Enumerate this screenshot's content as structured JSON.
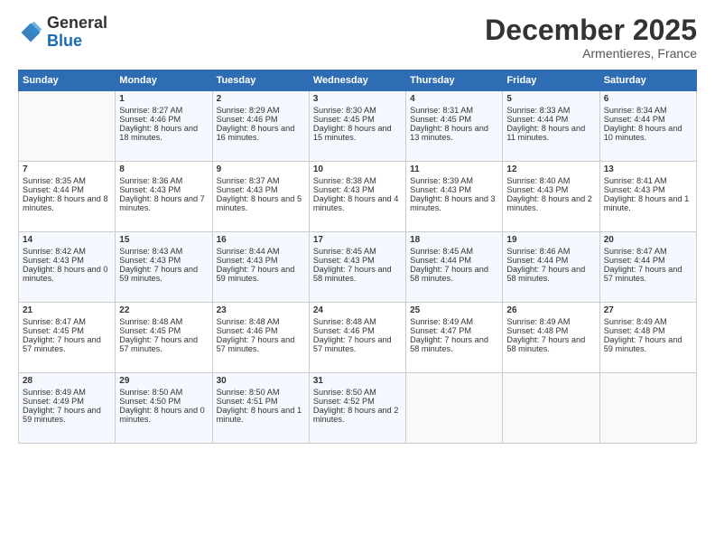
{
  "header": {
    "logo_general": "General",
    "logo_blue": "Blue",
    "month_title": "December 2025",
    "location": "Armentieres, France"
  },
  "days_of_week": [
    "Sunday",
    "Monday",
    "Tuesday",
    "Wednesday",
    "Thursday",
    "Friday",
    "Saturday"
  ],
  "weeks": [
    [
      {
        "day": "",
        "sunrise": "",
        "sunset": "",
        "daylight": "",
        "empty": true
      },
      {
        "day": "1",
        "sunrise": "Sunrise: 8:27 AM",
        "sunset": "Sunset: 4:46 PM",
        "daylight": "Daylight: 8 hours and 18 minutes."
      },
      {
        "day": "2",
        "sunrise": "Sunrise: 8:29 AM",
        "sunset": "Sunset: 4:46 PM",
        "daylight": "Daylight: 8 hours and 16 minutes."
      },
      {
        "day": "3",
        "sunrise": "Sunrise: 8:30 AM",
        "sunset": "Sunset: 4:45 PM",
        "daylight": "Daylight: 8 hours and 15 minutes."
      },
      {
        "day": "4",
        "sunrise": "Sunrise: 8:31 AM",
        "sunset": "Sunset: 4:45 PM",
        "daylight": "Daylight: 8 hours and 13 minutes."
      },
      {
        "day": "5",
        "sunrise": "Sunrise: 8:33 AM",
        "sunset": "Sunset: 4:44 PM",
        "daylight": "Daylight: 8 hours and 11 minutes."
      },
      {
        "day": "6",
        "sunrise": "Sunrise: 8:34 AM",
        "sunset": "Sunset: 4:44 PM",
        "daylight": "Daylight: 8 hours and 10 minutes."
      }
    ],
    [
      {
        "day": "7",
        "sunrise": "Sunrise: 8:35 AM",
        "sunset": "Sunset: 4:44 PM",
        "daylight": "Daylight: 8 hours and 8 minutes."
      },
      {
        "day": "8",
        "sunrise": "Sunrise: 8:36 AM",
        "sunset": "Sunset: 4:43 PM",
        "daylight": "Daylight: 8 hours and 7 minutes."
      },
      {
        "day": "9",
        "sunrise": "Sunrise: 8:37 AM",
        "sunset": "Sunset: 4:43 PM",
        "daylight": "Daylight: 8 hours and 5 minutes."
      },
      {
        "day": "10",
        "sunrise": "Sunrise: 8:38 AM",
        "sunset": "Sunset: 4:43 PM",
        "daylight": "Daylight: 8 hours and 4 minutes."
      },
      {
        "day": "11",
        "sunrise": "Sunrise: 8:39 AM",
        "sunset": "Sunset: 4:43 PM",
        "daylight": "Daylight: 8 hours and 3 minutes."
      },
      {
        "day": "12",
        "sunrise": "Sunrise: 8:40 AM",
        "sunset": "Sunset: 4:43 PM",
        "daylight": "Daylight: 8 hours and 2 minutes."
      },
      {
        "day": "13",
        "sunrise": "Sunrise: 8:41 AM",
        "sunset": "Sunset: 4:43 PM",
        "daylight": "Daylight: 8 hours and 1 minute."
      }
    ],
    [
      {
        "day": "14",
        "sunrise": "Sunrise: 8:42 AM",
        "sunset": "Sunset: 4:43 PM",
        "daylight": "Daylight: 8 hours and 0 minutes."
      },
      {
        "day": "15",
        "sunrise": "Sunrise: 8:43 AM",
        "sunset": "Sunset: 4:43 PM",
        "daylight": "Daylight: 7 hours and 59 minutes."
      },
      {
        "day": "16",
        "sunrise": "Sunrise: 8:44 AM",
        "sunset": "Sunset: 4:43 PM",
        "daylight": "Daylight: 7 hours and 59 minutes."
      },
      {
        "day": "17",
        "sunrise": "Sunrise: 8:45 AM",
        "sunset": "Sunset: 4:43 PM",
        "daylight": "Daylight: 7 hours and 58 minutes."
      },
      {
        "day": "18",
        "sunrise": "Sunrise: 8:45 AM",
        "sunset": "Sunset: 4:44 PM",
        "daylight": "Daylight: 7 hours and 58 minutes."
      },
      {
        "day": "19",
        "sunrise": "Sunrise: 8:46 AM",
        "sunset": "Sunset: 4:44 PM",
        "daylight": "Daylight: 7 hours and 58 minutes."
      },
      {
        "day": "20",
        "sunrise": "Sunrise: 8:47 AM",
        "sunset": "Sunset: 4:44 PM",
        "daylight": "Daylight: 7 hours and 57 minutes."
      }
    ],
    [
      {
        "day": "21",
        "sunrise": "Sunrise: 8:47 AM",
        "sunset": "Sunset: 4:45 PM",
        "daylight": "Daylight: 7 hours and 57 minutes."
      },
      {
        "day": "22",
        "sunrise": "Sunrise: 8:48 AM",
        "sunset": "Sunset: 4:45 PM",
        "daylight": "Daylight: 7 hours and 57 minutes."
      },
      {
        "day": "23",
        "sunrise": "Sunrise: 8:48 AM",
        "sunset": "Sunset: 4:46 PM",
        "daylight": "Daylight: 7 hours and 57 minutes."
      },
      {
        "day": "24",
        "sunrise": "Sunrise: 8:48 AM",
        "sunset": "Sunset: 4:46 PM",
        "daylight": "Daylight: 7 hours and 57 minutes."
      },
      {
        "day": "25",
        "sunrise": "Sunrise: 8:49 AM",
        "sunset": "Sunset: 4:47 PM",
        "daylight": "Daylight: 7 hours and 58 minutes."
      },
      {
        "day": "26",
        "sunrise": "Sunrise: 8:49 AM",
        "sunset": "Sunset: 4:48 PM",
        "daylight": "Daylight: 7 hours and 58 minutes."
      },
      {
        "day": "27",
        "sunrise": "Sunrise: 8:49 AM",
        "sunset": "Sunset: 4:48 PM",
        "daylight": "Daylight: 7 hours and 59 minutes."
      }
    ],
    [
      {
        "day": "28",
        "sunrise": "Sunrise: 8:49 AM",
        "sunset": "Sunset: 4:49 PM",
        "daylight": "Daylight: 7 hours and 59 minutes."
      },
      {
        "day": "29",
        "sunrise": "Sunrise: 8:50 AM",
        "sunset": "Sunset: 4:50 PM",
        "daylight": "Daylight: 8 hours and 0 minutes."
      },
      {
        "day": "30",
        "sunrise": "Sunrise: 8:50 AM",
        "sunset": "Sunset: 4:51 PM",
        "daylight": "Daylight: 8 hours and 1 minute."
      },
      {
        "day": "31",
        "sunrise": "Sunrise: 8:50 AM",
        "sunset": "Sunset: 4:52 PM",
        "daylight": "Daylight: 8 hours and 2 minutes."
      },
      {
        "day": "",
        "sunrise": "",
        "sunset": "",
        "daylight": "",
        "empty": true
      },
      {
        "day": "",
        "sunrise": "",
        "sunset": "",
        "daylight": "",
        "empty": true
      },
      {
        "day": "",
        "sunrise": "",
        "sunset": "",
        "daylight": "",
        "empty": true
      }
    ]
  ]
}
